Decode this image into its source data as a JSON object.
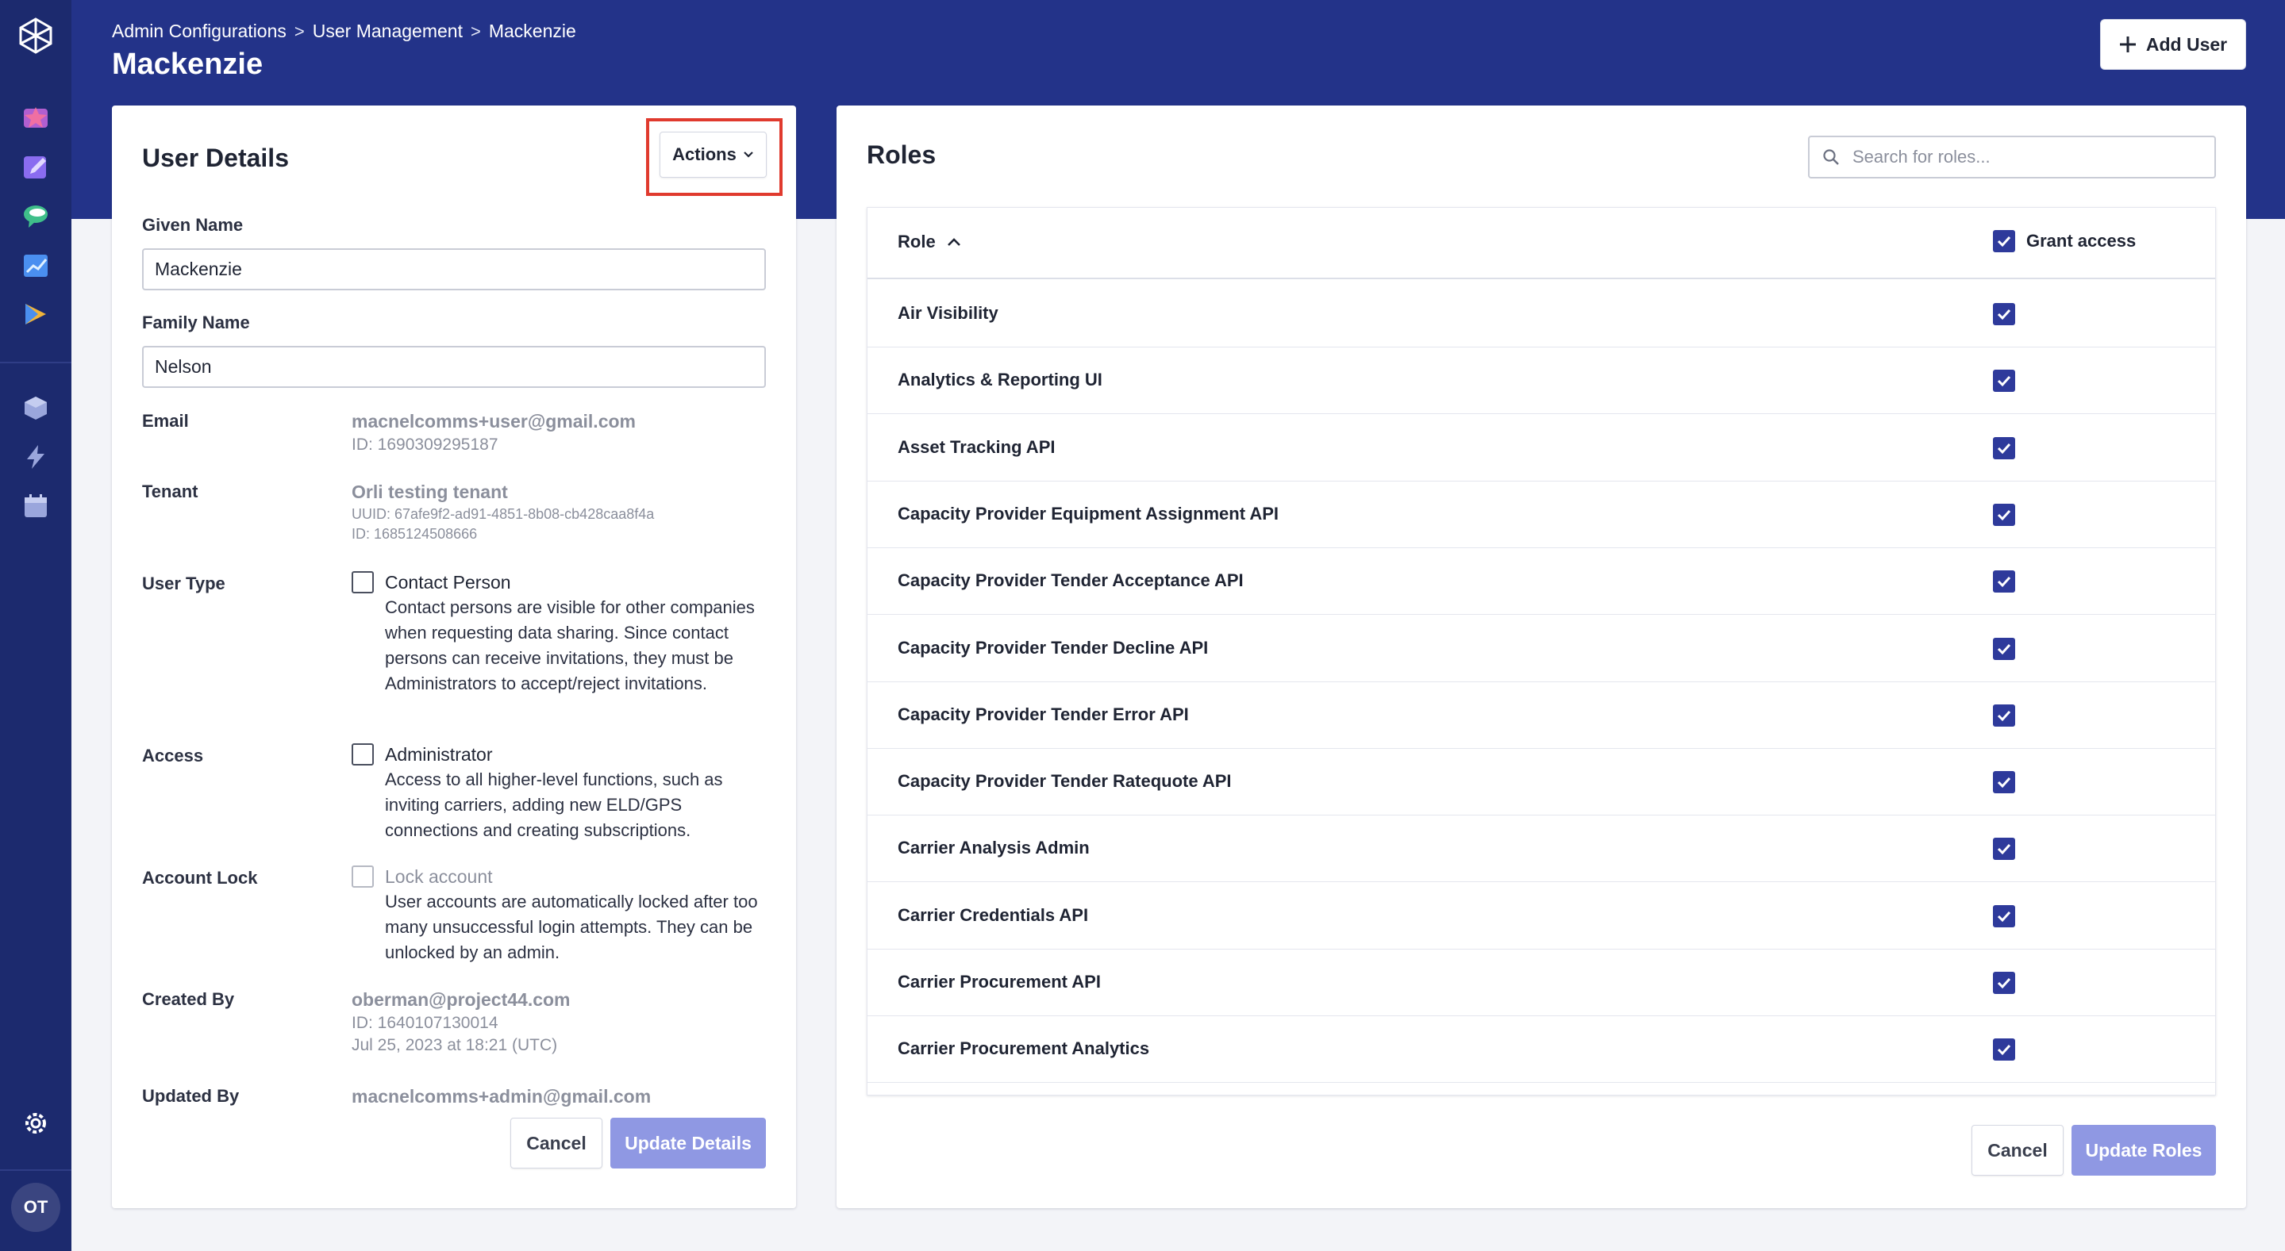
{
  "rail": {
    "nav_icons": [
      "logo-hex-icon",
      "star-app-icon",
      "pencil-app-icon",
      "chat-app-icon",
      "chart-app-icon",
      "flag-app-icon",
      "box-icon",
      "bolt-icon",
      "calendar-icon",
      "gear-icon"
    ],
    "avatar_initials": "OT"
  },
  "header": {
    "breadcrumb": [
      "Admin Configurations",
      "User Management",
      "Mackenzie"
    ],
    "breadcrumb_separator": ">",
    "title": "Mackenzie",
    "add_user_label": "Add User"
  },
  "user_details": {
    "title": "User Details",
    "actions_label": "Actions",
    "given_name_label": "Given Name",
    "given_name_value": "Mackenzie",
    "family_name_label": "Family Name",
    "family_name_value": "Nelson",
    "email_label": "Email",
    "email_value": "macnelcomms+user@gmail.com",
    "email_id": "ID: 1690309295187",
    "tenant_label": "Tenant",
    "tenant_value": "Orli testing tenant",
    "tenant_uuid": "UUID: 67afe9f2-ad91-4851-8b08-cb428caa8f4a",
    "tenant_id": "ID: 1685124508666",
    "user_type_label": "User Type",
    "contact_person_label": "Contact Person",
    "contact_person_desc": "Contact persons are visible for other companies when requesting data sharing. Since contact persons can receive invitations, they must be Administrators to accept/reject invitations.",
    "access_label": "Access",
    "administrator_label": "Administrator",
    "administrator_desc": "Access to all higher-level functions, such as inviting carriers, adding new ELD/GPS connections and creating subscriptions.",
    "account_lock_label": "Account Lock",
    "lock_account_label": "Lock account",
    "lock_account_desc": "User accounts are automatically locked after too many unsuccessful login attempts. They can be unlocked by an admin.",
    "created_by_label": "Created By",
    "created_by_value": "oberman@project44.com",
    "created_by_id": "ID: 1640107130014",
    "created_by_date": "Jul 25, 2023 at 18:21 (UTC)",
    "updated_by_label": "Updated By",
    "updated_by_value": "macnelcomms+admin@gmail.com",
    "cancel_label": "Cancel",
    "update_label": "Update Details"
  },
  "roles": {
    "title": "Roles",
    "search_placeholder": "Search for roles...",
    "col_role": "Role",
    "col_grant": "Grant access",
    "items": [
      "Air Visibility",
      "Analytics & Reporting UI",
      "Asset Tracking API",
      "Capacity Provider Equipment Assignment API",
      "Capacity Provider Tender Acceptance API",
      "Capacity Provider Tender Decline API",
      "Capacity Provider Tender Error API",
      "Capacity Provider Tender Ratequote API",
      "Carrier Analysis Admin",
      "Carrier Credentials API",
      "Carrier Procurement API",
      "Carrier Procurement Analytics"
    ],
    "cancel_label": "Cancel",
    "update_label": "Update Roles"
  },
  "colors": {
    "rail": "#1c2a6e",
    "header_band": "#233389",
    "checkbox_checked": "#2e3a9b",
    "primary_button_disabled": "#8f98e3",
    "highlight_box": "#e03a2e"
  }
}
